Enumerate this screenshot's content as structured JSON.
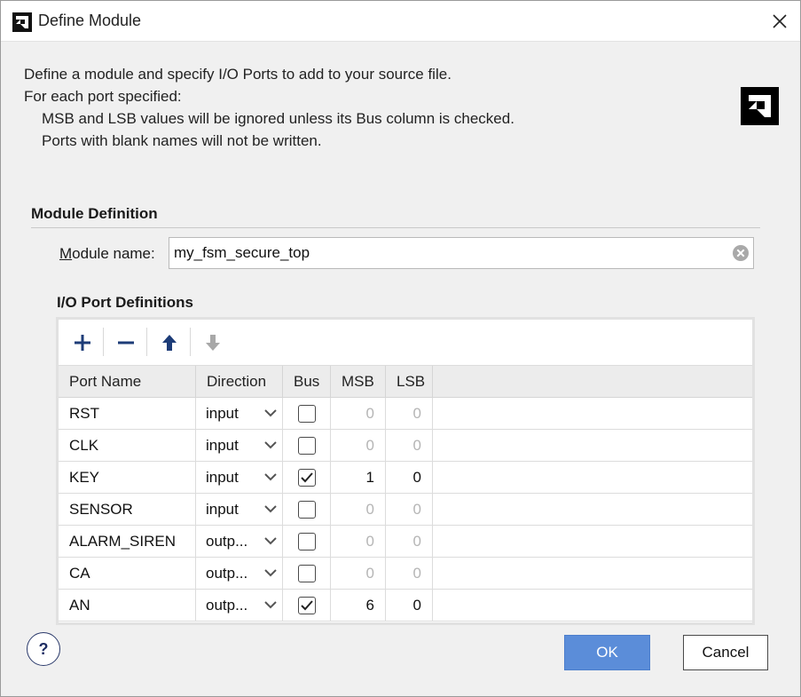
{
  "window": {
    "title": "Define Module"
  },
  "description": {
    "line1": "Define a module and specify I/O Ports to add to your source file.",
    "line2": "For each port specified:",
    "line3": "MSB and LSB values will be ignored unless its Bus column is checked.",
    "line4": "Ports with blank names will not be written."
  },
  "module_definition": {
    "section_title": "Module Definition",
    "label_prefix": "M",
    "label_rest": "odule name:",
    "value": "my_fsm_secure_top"
  },
  "io_ports": {
    "section_title": "I/O Port Definitions",
    "columns": [
      "Port Name",
      "Direction",
      "Bus",
      "MSB",
      "LSB"
    ],
    "rows": [
      {
        "name": "RST",
        "direction": "input",
        "bus": false,
        "msb": "0",
        "lsb": "0"
      },
      {
        "name": "CLK",
        "direction": "input",
        "bus": false,
        "msb": "0",
        "lsb": "0"
      },
      {
        "name": "KEY",
        "direction": "input",
        "bus": true,
        "msb": "1",
        "lsb": "0"
      },
      {
        "name": "SENSOR",
        "direction": "input",
        "bus": false,
        "msb": "0",
        "lsb": "0"
      },
      {
        "name": "ALARM_SIREN",
        "direction": "outp...",
        "bus": false,
        "msb": "0",
        "lsb": "0"
      },
      {
        "name": "CA",
        "direction": "outp...",
        "bus": false,
        "msb": "0",
        "lsb": "0"
      },
      {
        "name": "AN",
        "direction": "outp...",
        "bus": true,
        "msb": "6",
        "lsb": "0"
      }
    ]
  },
  "buttons": {
    "help": "?",
    "ok": "OK",
    "cancel": "Cancel"
  },
  "colors": {
    "accent": "#5b8dd9",
    "toolbar_icon": "#1d3c78"
  }
}
